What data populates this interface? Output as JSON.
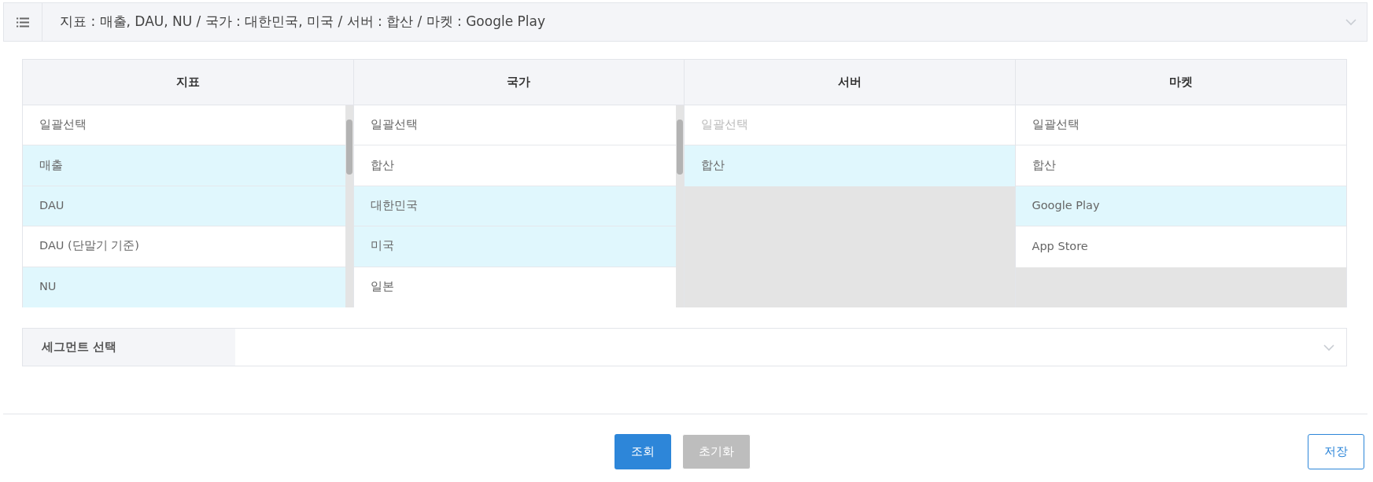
{
  "filter_bar": {
    "summary": "지표 : 매출, DAU, NU / 국가 : 대한민국, 미국 / 서버 : 합산 / 마켓 : Google Play",
    "expanded": false
  },
  "columns": [
    {
      "title": "지표",
      "scrollable": true,
      "items": [
        {
          "label": "일괄선택",
          "selected": false
        },
        {
          "label": "매출",
          "selected": true
        },
        {
          "label": "DAU",
          "selected": true
        },
        {
          "label": "DAU (단말기 기준)",
          "selected": false
        },
        {
          "label": "NU",
          "selected": true
        }
      ]
    },
    {
      "title": "국가",
      "scrollable": true,
      "items": [
        {
          "label": "일괄선택",
          "selected": false
        },
        {
          "label": "합산",
          "selected": false
        },
        {
          "label": "대한민국",
          "selected": true
        },
        {
          "label": "미국",
          "selected": true
        },
        {
          "label": "일본",
          "selected": false
        }
      ]
    },
    {
      "title": "서버",
      "scrollable": false,
      "items": [
        {
          "label": "일괄선택",
          "selected": false,
          "disabled": true
        },
        {
          "label": "합산",
          "selected": true,
          "disabled": false
        }
      ]
    },
    {
      "title": "마켓",
      "scrollable": false,
      "items": [
        {
          "label": "일괄선택",
          "selected": false
        },
        {
          "label": "합산",
          "selected": false
        },
        {
          "label": "Google Play",
          "selected": true
        },
        {
          "label": "App Store",
          "selected": false
        }
      ]
    }
  ],
  "segment": {
    "label": "세그먼트 선택"
  },
  "buttons": [
    {
      "label": "조회",
      "kind": "primary"
    },
    {
      "label": "초기화",
      "kind": "disabled"
    },
    {
      "label": "저장",
      "kind": "outline"
    }
  ]
}
